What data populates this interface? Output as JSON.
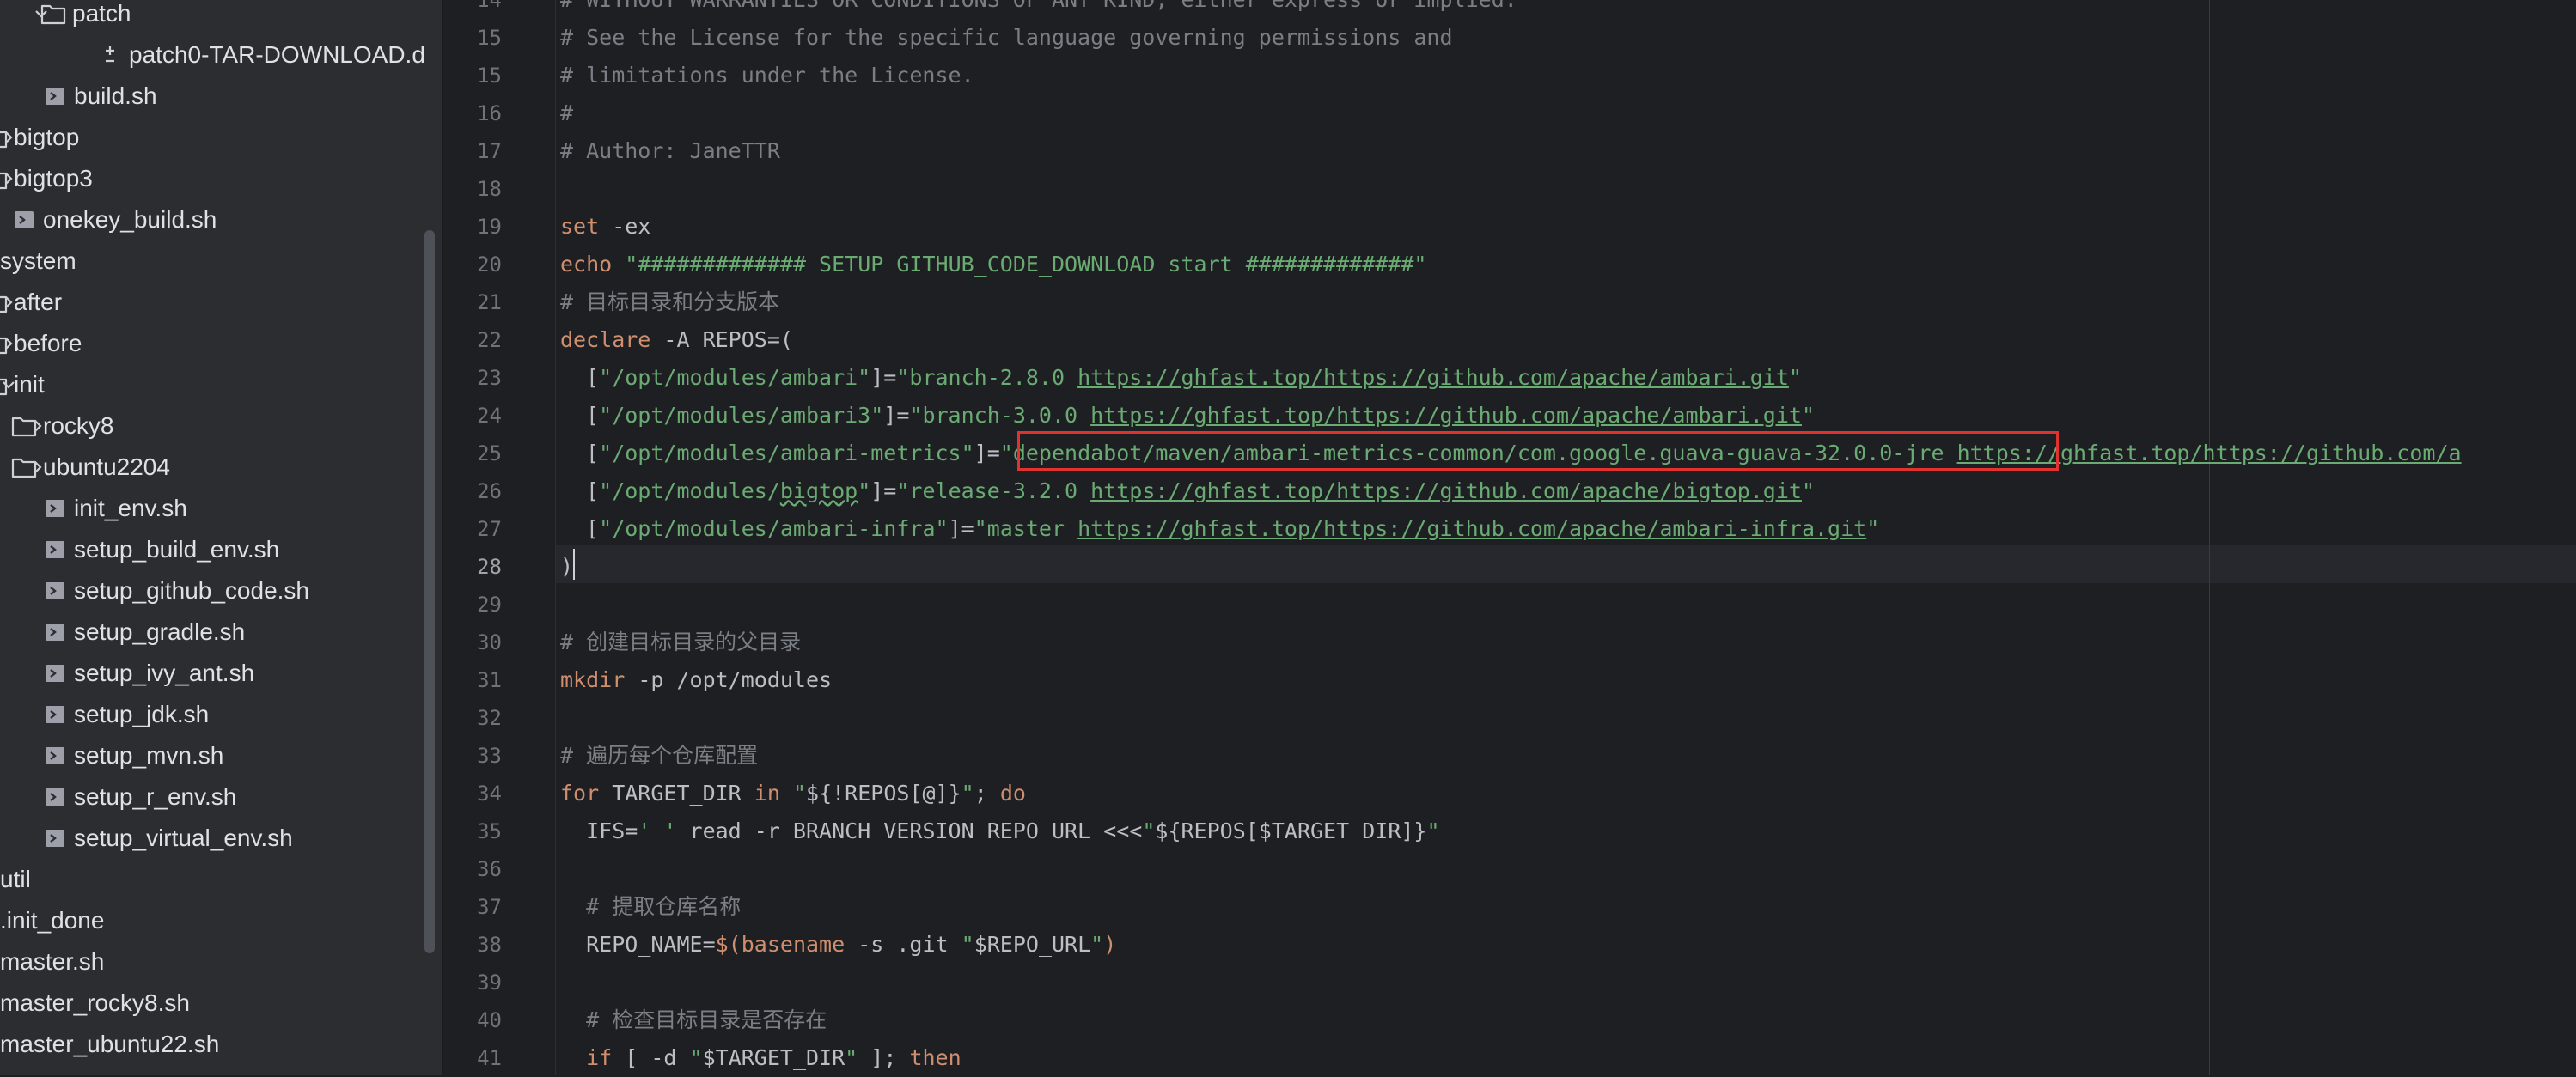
{
  "sidebar": {
    "items": [
      {
        "label": "patch",
        "type": "folder",
        "expanded": true
      },
      {
        "label": "patch0-TAR-DOWNLOAD.d",
        "type": "diff-file"
      },
      {
        "label": "build.sh",
        "type": "shell-file"
      },
      {
        "label": "bigtop",
        "type": "folder",
        "expanded": false
      },
      {
        "label": "bigtop3",
        "type": "folder",
        "expanded": false
      },
      {
        "label": "onekey_build.sh",
        "type": "shell-file"
      },
      {
        "label": "system",
        "type": "folder",
        "expanded": true
      },
      {
        "label": "after",
        "type": "folder",
        "expanded": false
      },
      {
        "label": "before",
        "type": "folder",
        "expanded": false
      },
      {
        "label": "init",
        "type": "folder",
        "expanded": true
      },
      {
        "label": "rocky8",
        "type": "folder",
        "expanded": false
      },
      {
        "label": "ubuntu2204",
        "type": "folder",
        "expanded": false
      },
      {
        "label": "init_env.sh",
        "type": "shell-file"
      },
      {
        "label": "setup_build_env.sh",
        "type": "shell-file"
      },
      {
        "label": "setup_github_code.sh",
        "type": "shell-file"
      },
      {
        "label": "setup_gradle.sh",
        "type": "shell-file"
      },
      {
        "label": "setup_ivy_ant.sh",
        "type": "shell-file"
      },
      {
        "label": "setup_jdk.sh",
        "type": "shell-file"
      },
      {
        "label": "setup_mvn.sh",
        "type": "shell-file"
      },
      {
        "label": "setup_r_env.sh",
        "type": "shell-file"
      },
      {
        "label": "setup_virtual_env.sh",
        "type": "shell-file"
      },
      {
        "label": "util",
        "type": "folder",
        "expanded": false
      },
      {
        "label": ".init_done",
        "type": "text-file"
      },
      {
        "label": "master.sh",
        "type": "shell-file"
      },
      {
        "label": "master_rocky8.sh",
        "type": "shell-file"
      },
      {
        "label": "master_ubuntu22.sh",
        "type": "shell-file"
      }
    ]
  },
  "editor": {
    "active_line": "28",
    "lines": [
      {
        "n": "14",
        "tokens": [
          {
            "t": "# WITHOUT WARRANTIES OR CONDITIONS OF ANY KIND, either express or implied.",
            "c": "cm"
          }
        ]
      },
      {
        "n": "15",
        "tokens": [
          {
            "t": "# See the License for the specific language governing permissions and",
            "c": "cm"
          }
        ]
      },
      {
        "n": "15",
        "tokens": [
          {
            "t": "# limitations under the License.",
            "c": "cm"
          }
        ]
      },
      {
        "n": "16",
        "tokens": [
          {
            "t": "#",
            "c": "cm"
          }
        ]
      },
      {
        "n": "17",
        "tokens": [
          {
            "t": "# Author: JaneTTR",
            "c": "cm"
          }
        ]
      },
      {
        "n": "18",
        "tokens": []
      },
      {
        "n": "19",
        "tokens": [
          {
            "t": "set",
            "c": "kw"
          },
          {
            "t": " -ex",
            "c": "pl"
          }
        ]
      },
      {
        "n": "20",
        "tokens": [
          {
            "t": "echo",
            "c": "kw"
          },
          {
            "t": " ",
            "c": "pl"
          },
          {
            "t": "\"############# SETUP GITHUB_CODE_DOWNLOAD start #############\"",
            "c": "str"
          }
        ]
      },
      {
        "n": "21",
        "tokens": [
          {
            "t": "# 目标目录和分支版本",
            "c": "cm"
          }
        ]
      },
      {
        "n": "22",
        "tokens": [
          {
            "t": "declare",
            "c": "kw"
          },
          {
            "t": " -A REPOS=(",
            "c": "pl"
          }
        ]
      },
      {
        "n": "23",
        "tokens": [
          {
            "t": "  [",
            "c": "pl"
          },
          {
            "t": "\"/opt/modules/ambari\"",
            "c": "str"
          },
          {
            "t": "]=",
            "c": "pl"
          },
          {
            "t": "\"branch-2.8.0 ",
            "c": "str"
          },
          {
            "t": "https://ghfast.top/https://github.com/apache/ambari.git",
            "c": "url"
          },
          {
            "t": "\"",
            "c": "str"
          }
        ]
      },
      {
        "n": "24",
        "tokens": [
          {
            "t": "  [",
            "c": "pl"
          },
          {
            "t": "\"/opt/modules/ambari3\"",
            "c": "str"
          },
          {
            "t": "]=",
            "c": "pl"
          },
          {
            "t": "\"branch-3.0.0 ",
            "c": "str"
          },
          {
            "t": "https://ghfast.top/https://github.com/apache/ambari.git",
            "c": "url"
          },
          {
            "t": "\"",
            "c": "str"
          }
        ]
      },
      {
        "n": "25",
        "tokens": [
          {
            "t": "  [",
            "c": "pl"
          },
          {
            "t": "\"/opt/modules/ambari-metrics\"",
            "c": "str"
          },
          {
            "t": "]=",
            "c": "pl"
          },
          {
            "t": "\"dependabot/maven/ambari-metrics-common/com.google.guava-guava-32.0.0-jre ",
            "c": "str"
          },
          {
            "t": "https://ghfast.top/https://github.com/a",
            "c": "url"
          }
        ]
      },
      {
        "n": "26",
        "tokens": [
          {
            "t": "  [",
            "c": "pl"
          },
          {
            "t": "\"/opt/modules/",
            "c": "str"
          },
          {
            "t": "bigtop",
            "c": "str ty"
          },
          {
            "t": "\"",
            "c": "str"
          },
          {
            "t": "]=",
            "c": "pl"
          },
          {
            "t": "\"release-3.2.0 ",
            "c": "str"
          },
          {
            "t": "https://ghfast.top/https://github.com/apache/bigtop.git",
            "c": "url"
          },
          {
            "t": "\"",
            "c": "str"
          }
        ]
      },
      {
        "n": "27",
        "tokens": [
          {
            "t": "  [",
            "c": "pl"
          },
          {
            "t": "\"/opt/modules/ambari-infra\"",
            "c": "str"
          },
          {
            "t": "]=",
            "c": "pl"
          },
          {
            "t": "\"master ",
            "c": "str"
          },
          {
            "t": "https://ghfast.top/https://github.com/apache/ambari-infra.git",
            "c": "url"
          },
          {
            "t": "\"",
            "c": "str"
          }
        ]
      },
      {
        "n": "28",
        "tokens": [
          {
            "t": ")",
            "c": "pl"
          }
        ]
      },
      {
        "n": "29",
        "tokens": []
      },
      {
        "n": "30",
        "tokens": [
          {
            "t": "# 创建目标目录的父目录",
            "c": "cm"
          }
        ]
      },
      {
        "n": "31",
        "tokens": [
          {
            "t": "mkdir",
            "c": "kw"
          },
          {
            "t": " -p /opt/modules",
            "c": "pl"
          }
        ]
      },
      {
        "n": "32",
        "tokens": []
      },
      {
        "n": "33",
        "tokens": [
          {
            "t": "# 遍历每个仓库配置",
            "c": "cm"
          }
        ]
      },
      {
        "n": "34",
        "tokens": [
          {
            "t": "for",
            "c": "kw"
          },
          {
            "t": " TARGET_DIR ",
            "c": "pl"
          },
          {
            "t": "in",
            "c": "kw"
          },
          {
            "t": " ",
            "c": "pl"
          },
          {
            "t": "\"",
            "c": "str"
          },
          {
            "t": "${!REPOS[@]}",
            "c": "pl"
          },
          {
            "t": "\"",
            "c": "str"
          },
          {
            "t": "; ",
            "c": "pl"
          },
          {
            "t": "do",
            "c": "kw"
          }
        ]
      },
      {
        "n": "35",
        "tokens": [
          {
            "t": "  IFS=",
            "c": "pl"
          },
          {
            "t": "' '",
            "c": "str"
          },
          {
            "t": " read -r BRANCH_VERSION REPO_URL <<<",
            "c": "pl"
          },
          {
            "t": "\"",
            "c": "str"
          },
          {
            "t": "${REPOS[$TARGET_DIR]}",
            "c": "pl"
          },
          {
            "t": "\"",
            "c": "str"
          }
        ]
      },
      {
        "n": "36",
        "tokens": []
      },
      {
        "n": "37",
        "tokens": [
          {
            "t": "  # 提取仓库名称",
            "c": "cm"
          }
        ]
      },
      {
        "n": "38",
        "tokens": [
          {
            "t": "  REPO_NAME=",
            "c": "pl"
          },
          {
            "t": "$(",
            "c": "kw"
          },
          {
            "t": "basename",
            "c": "kw"
          },
          {
            "t": " -s .git ",
            "c": "pl"
          },
          {
            "t": "\"",
            "c": "str"
          },
          {
            "t": "$REPO_URL",
            "c": "pl"
          },
          {
            "t": "\"",
            "c": "str"
          },
          {
            "t": ")",
            "c": "kw"
          }
        ]
      },
      {
        "n": "39",
        "tokens": []
      },
      {
        "n": "40",
        "tokens": [
          {
            "t": "  # 检查目标目录是否存在",
            "c": "cm"
          }
        ]
      },
      {
        "n": "41",
        "tokens": [
          {
            "t": "  if",
            "c": "kw"
          },
          {
            "t": " [ -d ",
            "c": "pl"
          },
          {
            "t": "\"",
            "c": "str"
          },
          {
            "t": "$TARGET_DIR",
            "c": "pl"
          },
          {
            "t": "\"",
            "c": "str"
          },
          {
            "t": " ]; ",
            "c": "pl"
          },
          {
            "t": "then",
            "c": "kw"
          }
        ]
      }
    ]
  },
  "colors": {
    "sidebar_bg": "#2b2d30",
    "editor_bg": "#1e1f22",
    "comment": "#7a7e85",
    "keyword": "#cf8e6d",
    "string": "#6aab73",
    "plain": "#bcbec4",
    "highlight_box": "#e0322e"
  }
}
